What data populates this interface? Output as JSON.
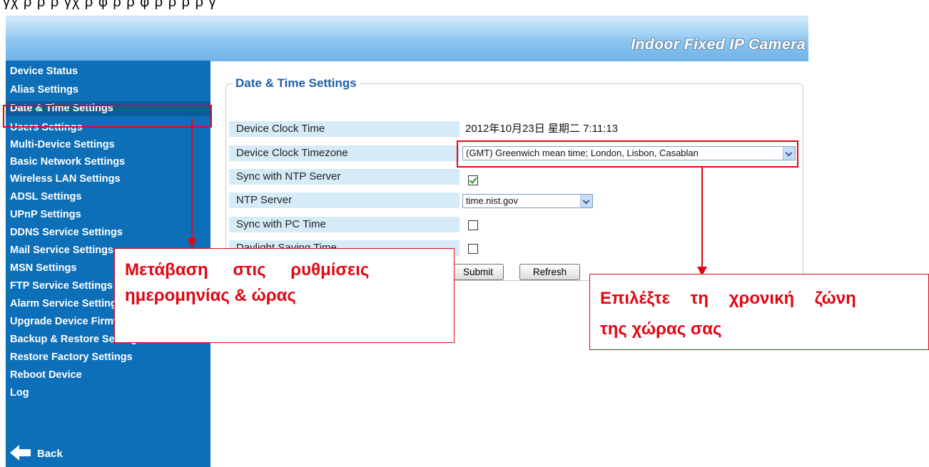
{
  "top_text": "γχ ρ ρ ρ γχ ρ φ ρ ρ φ ρ ρ ρ ρ γ",
  "header": {
    "product_name": "Indoor Fixed IP Camera"
  },
  "sidebar": {
    "items": [
      "Device Status",
      "Alias Settings",
      "Date & Time Settings",
      "Users Settings",
      "Multi-Device Settings",
      "Basic Network Settings",
      "Wireless LAN Settings",
      "ADSL Settings",
      "UPnP Settings",
      "DDNS Service Settings",
      "Mail Service Settings",
      "MSN Settings",
      "FTP Service Settings",
      "Alarm Service Settings",
      "Upgrade Device Firmware",
      "Backup & Restore Settings",
      "Restore Factory Settings",
      "Reboot Device",
      "Log"
    ],
    "active_index": 2,
    "back_label": "Back"
  },
  "panel": {
    "title": "Date & Time Settings",
    "rows": {
      "clock_time": {
        "label": "Device Clock Time",
        "value": "2012年10月23日 星期二 7:11:13"
      },
      "timezone": {
        "label": "Device Clock Timezone",
        "value": "(GMT) Greenwich mean time; London, Lisbon, Casablan"
      },
      "sync_ntp": {
        "label": "Sync with NTP Server",
        "checked": true
      },
      "ntp_server": {
        "label": "NTP Server",
        "value": "time.nist.gov"
      },
      "sync_pc": {
        "label": "Sync with PC Time",
        "checked": false
      },
      "dst": {
        "label": "Daylight Saving Time",
        "checked": false
      }
    },
    "submit_label": "Submit",
    "refresh_label": "Refresh"
  },
  "callouts": {
    "left": {
      "line1": "Μετάβαση στις ρυθμίσεις",
      "line2": "ημερομηνίας & ώρας"
    },
    "right": {
      "line1": "Επιλέξτε τη χρονική ζώνη",
      "line2": "της χώρας σας"
    }
  },
  "colors": {
    "accent_red": "#e30613",
    "sidebar_blue": "#0d6fb8",
    "title_blue": "#1f5ea8"
  }
}
